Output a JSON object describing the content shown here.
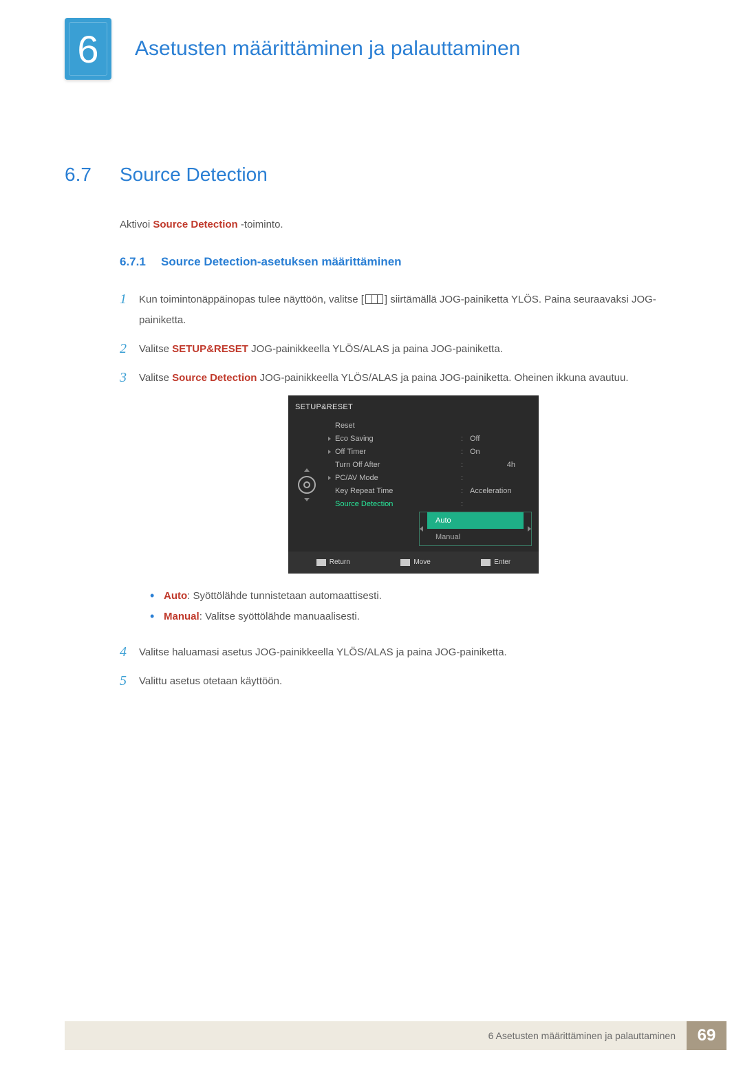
{
  "chapter": {
    "number": "6",
    "title": "Asetusten määrittäminen ja palauttaminen"
  },
  "section": {
    "number": "6.7",
    "title": "Source Detection"
  },
  "intro": {
    "prefix": "Aktivoi ",
    "term": "Source Detection",
    "suffix": " -toiminto."
  },
  "subsection": {
    "number": "6.7.1",
    "title": "Source Detection-asetuksen määrittäminen"
  },
  "steps": {
    "s1": {
      "pre": "Kun toimintonäppäinopas tulee näyttöön, valitse [",
      "post": "] siirtämällä JOG-painiketta YLÖS. Paina seuraavaksi JOG-painiketta."
    },
    "s2": {
      "pre": "Valitse ",
      "bold": "SETUP&RESET",
      "post": " JOG-painikkeella YLÖS/ALAS ja paina JOG-painiketta."
    },
    "s3": {
      "pre": "Valitse ",
      "bold": "Source Detection",
      "post": " JOG-painikkeella YLÖS/ALAS ja paina JOG-painiketta. Oheinen ikkuna avautuu."
    },
    "bullets": {
      "auto": {
        "label": "Auto",
        "text": ": Syöttölähde tunnistetaan automaattisesti."
      },
      "manual": {
        "label": "Manual",
        "text": ": Valitse syöttölähde manuaalisesti."
      }
    },
    "s4": "Valitse haluamasi asetus JOG-painikkeella YLÖS/ALAS ja paina JOG-painiketta.",
    "s5": "Valittu asetus otetaan käyttöön."
  },
  "step_numbers": {
    "n1": "1",
    "n2": "2",
    "n3": "3",
    "n4": "4",
    "n5": "5"
  },
  "osd": {
    "title": "SETUP&RESET",
    "rows": {
      "reset": {
        "label": "Reset",
        "val": ""
      },
      "eco": {
        "label": "Eco Saving",
        "val": "Off"
      },
      "off": {
        "label": "Off Timer",
        "val": "On"
      },
      "turn": {
        "label": "Turn Off After",
        "val": "4h"
      },
      "pcav": {
        "label": "PC/AV Mode",
        "val": ""
      },
      "key": {
        "label": "Key Repeat Time",
        "val": "Acceleration"
      },
      "src": {
        "label": "Source Detection",
        "val": ""
      }
    },
    "dropdown": {
      "auto": "Auto",
      "manual": "Manual"
    },
    "footer": {
      "return": "Return",
      "move": "Move",
      "enter": "Enter"
    }
  },
  "footer": {
    "text": "6 Asetusten määrittäminen ja palauttaminen",
    "page": "69"
  }
}
